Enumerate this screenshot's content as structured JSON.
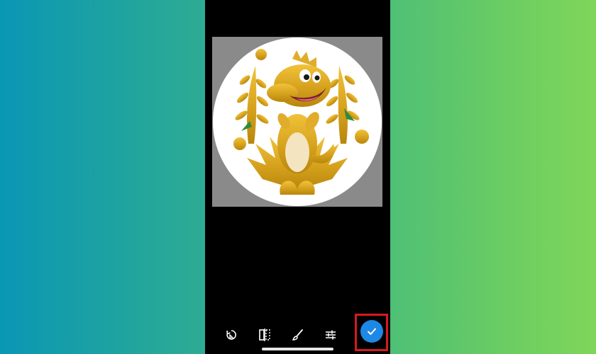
{
  "screen": {
    "title": "",
    "mode": "crop-editor"
  },
  "image": {
    "subject": "golden-dinosaur-illustration",
    "crop_shape": "circle"
  },
  "toolbar": {
    "items": [
      {
        "icon": "rotate-icon"
      },
      {
        "icon": "flip-icon"
      },
      {
        "icon": "brush-icon"
      },
      {
        "icon": "adjust-sliders-icon"
      }
    ],
    "confirm": {
      "icon": "checkmark-icon",
      "highlighted": true
    }
  },
  "colors": {
    "background_left": "#0a97b4",
    "background_right": "#7fd65a",
    "phone": "#000000",
    "confirm": "#1e88e5",
    "highlight": "#d71920",
    "gold": "#d9a520"
  }
}
